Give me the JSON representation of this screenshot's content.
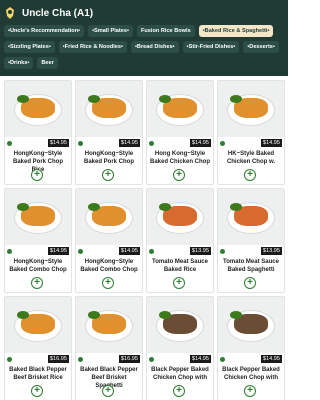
{
  "header": {
    "title": "Uncle Cha (A1)",
    "logo_icon": "uncle-cha-logo-icon"
  },
  "categories": {
    "row1": [
      {
        "label": "•Uncle's Recommendation•",
        "active": false
      },
      {
        "label": "•Small Plates•",
        "active": false
      },
      {
        "label": "Fusion Rice Bowls",
        "active": false
      },
      {
        "label": "•Baked Rice & Spaghetti•",
        "active": true
      }
    ],
    "row2": [
      {
        "label": "•Sizzling Plates•",
        "active": false
      },
      {
        "label": "•Fried Rice & Noodles•",
        "active": false
      },
      {
        "label": "•Bread Dishes•",
        "active": false
      },
      {
        "label": "•Stir-Fried Dishes•",
        "active": false
      },
      {
        "label": "•Desserts•",
        "active": false
      }
    ],
    "row3": [
      {
        "label": "•Drinks•",
        "active": false
      },
      {
        "label": "Beer",
        "active": false
      }
    ]
  },
  "items": [
    {
      "name": "HongKong~Style Baked Pork Chop Rice",
      "price": "$14.95",
      "food": "orange"
    },
    {
      "name": "HongKong~Style Baked Pork Chop",
      "price": "$14.95",
      "food": "orange"
    },
    {
      "name": "Hong Kong~Style Baked Chicken Chop",
      "price": "$14.95",
      "food": "orange"
    },
    {
      "name": "HK~Style Baked Chicken Chop w.",
      "price": "$14.95",
      "food": "orange"
    },
    {
      "name": "HongKong~Style Baked Combo Chop",
      "price": "$14.95",
      "food": "orange"
    },
    {
      "name": "HongKong~Style Baked Combo Chop",
      "price": "$14.95",
      "food": "orange"
    },
    {
      "name": "Tomato Meat Sauce Baked Rice",
      "price": "$13.95",
      "food": "red"
    },
    {
      "name": "Tomato Meat Sauce Baked Spaghetti",
      "price": "$13.95",
      "food": "red"
    },
    {
      "name": "Baked Black Pepper Beef Brisket Rice",
      "price": "$16.95",
      "food": "orange"
    },
    {
      "name": "Baked Black Pepper Beef Brisket Spaghetti",
      "price": "$16.95",
      "food": "orange"
    },
    {
      "name": "Black Pepper Baked Chicken Chop with",
      "price": "$14.95",
      "food": "brown"
    },
    {
      "name": "Black Pepper Baked Chicken Chop with",
      "price": "$14.95",
      "food": "brown"
    }
  ],
  "icons": {
    "info": "info-icon",
    "add": "plus-circle-icon",
    "add_symbol": "+"
  },
  "colors": {
    "header_bg": "#1f3b34",
    "chip_bg": "#2d4e46",
    "active_chip_bg": "#f3e6c9",
    "accent_green": "#2e7d32",
    "price_bg": "#1a1a1a"
  }
}
